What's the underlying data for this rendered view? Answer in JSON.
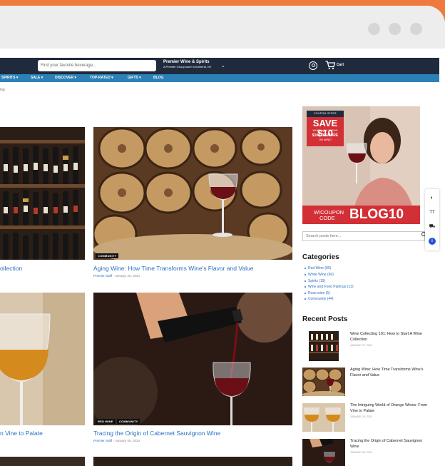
{
  "header": {
    "search_placeholder": "Find your favorite beverage...",
    "store_name": "Premier Wine & Spirits",
    "store_sub": "A Premier Group store in Amherst, NY",
    "cart_label": "Cart"
  },
  "nav": {
    "items": [
      "SPIRITS",
      "SALE",
      "DISCOVER",
      "TOP-RATED",
      "GIFTS",
      "BLOG"
    ]
  },
  "breadcrumb": "log",
  "posts": [
    {
      "title": "ollection",
      "author": "",
      "date": "",
      "tags": []
    },
    {
      "title": "Aging Wine: How Time Transforms Wine's Flavor and Value",
      "author": "Premier Staff",
      "date": "January 20, 2024",
      "tags": [
        "COMMUNITY"
      ]
    },
    {
      "title": "n Vine to Palate",
      "author": "",
      "date": "",
      "tags": []
    },
    {
      "title": "Tracing the Origin of Cabernet Sauvignon Wine",
      "author": "Premier Staff",
      "date": "January 05, 2024",
      "tags": [
        "RED WINE",
        "COMMUNITY"
      ]
    }
  ],
  "ad": {
    "badge": "COUPON OFFER",
    "save_line": "SAVE $10",
    "when_line": "WHEN YOU SPEND",
    "more_line": "$100 OR MORE",
    "on_line": "ON WINE!",
    "w_coupon": "W/COUPON",
    "code": "CODE",
    "coupon_code": "BLOG10"
  },
  "sidebar": {
    "search_placeholder": "Search posts here...",
    "categories_heading": "Categories",
    "categories": [
      "Red Wine (80)",
      "White Wine (66)",
      "Spirits (19)",
      "Wine and Food Pairings (13)",
      "Rose wine (5)",
      "Community (44)"
    ],
    "recent_heading": "Recent Posts",
    "recent": [
      {
        "title": "Wine Collecting 101: How to Start A Wine Collection",
        "date": "JANUARY 27, 2024"
      },
      {
        "title": "Aging Wine: How Time Transforms Wine's Flavor and Value",
        "date": "JANUARY 20, 2024"
      },
      {
        "title": "The Intriguing World of Orange Wines: From Vine to Palate",
        "date": "JANUARY 13, 2024"
      },
      {
        "title": "Tracing the Origin of Cabernet Sauvignon Wine",
        "date": "JANUARY 05, 2024"
      }
    ]
  },
  "colors": {
    "frame": "#ef7a3f",
    "header": "#1f2b3d",
    "nav": "#2b81b6",
    "link": "#2a6fc2",
    "ad_red": "#d32f36"
  },
  "icons": [
    "account-icon",
    "cart-icon",
    "contrast-icon",
    "text-size-icon",
    "cart-tool-icon",
    "info-icon",
    "search-icon"
  ]
}
